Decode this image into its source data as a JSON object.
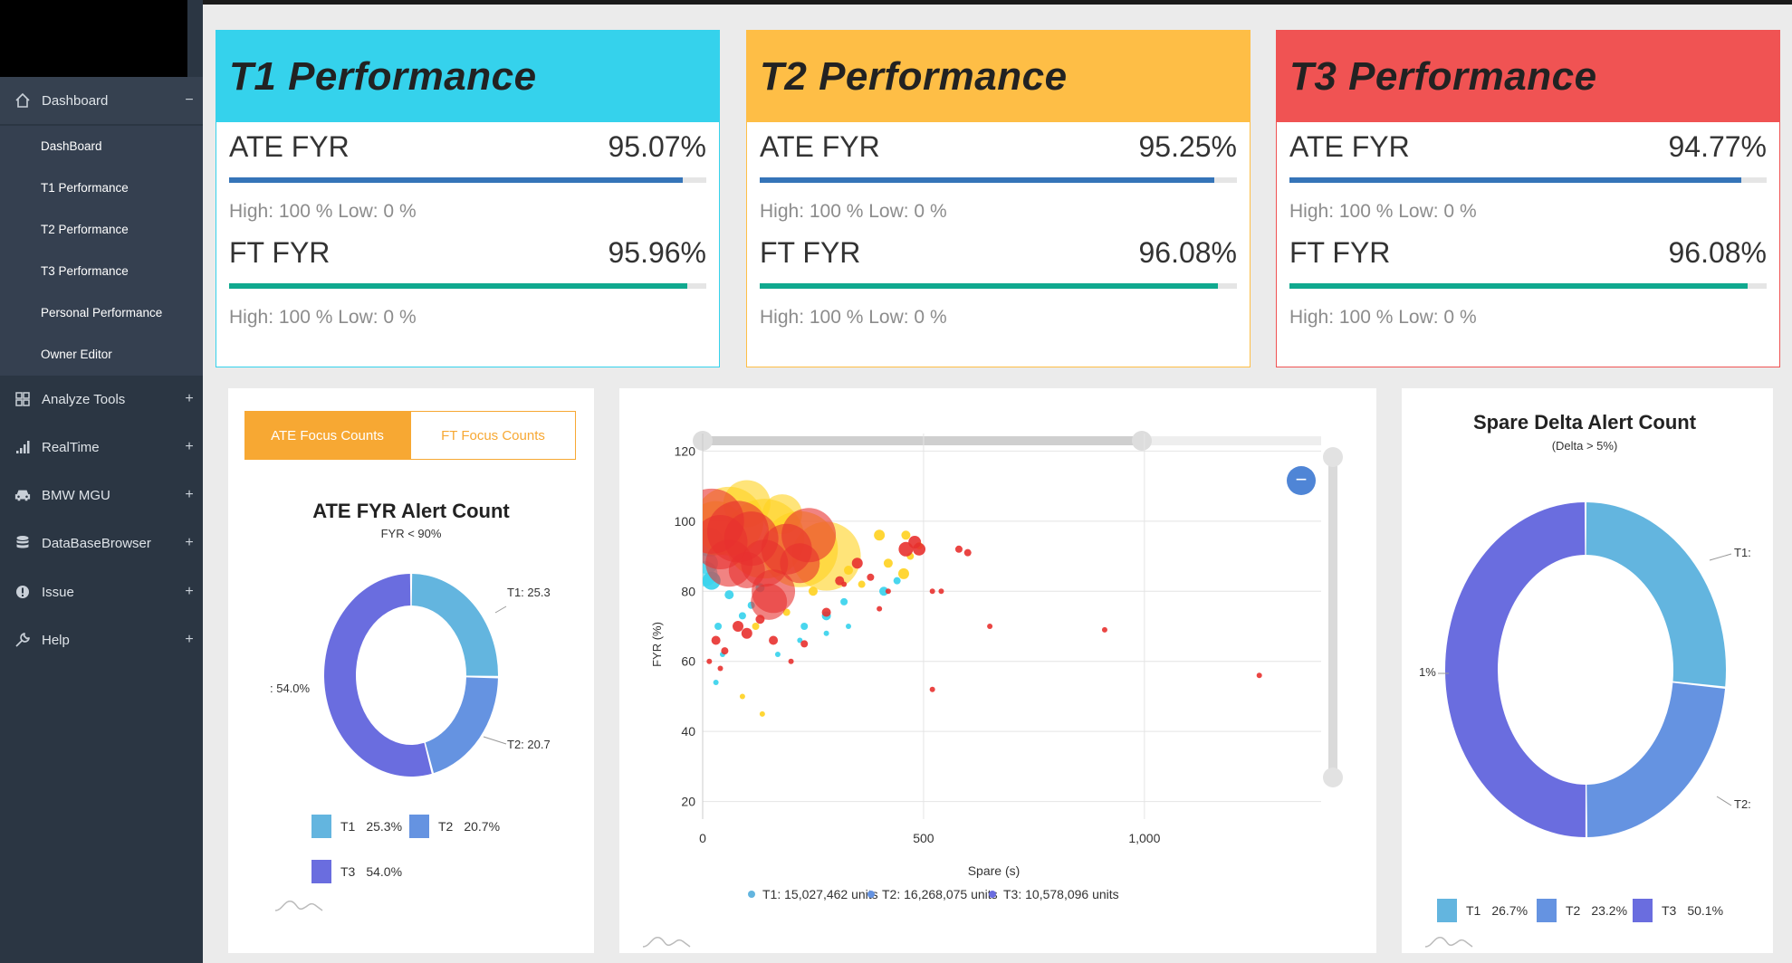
{
  "sidebar": {
    "items": [
      {
        "label": "Dashboard",
        "icon": "home-icon",
        "toggle": "−"
      },
      {
        "label": "Analyze Tools",
        "icon": "grid-icon",
        "toggle": "+"
      },
      {
        "label": "RealTime",
        "icon": "signal-icon",
        "toggle": "+"
      },
      {
        "label": "BMW MGU",
        "icon": "car-icon",
        "toggle": "+"
      },
      {
        "label": "DataBaseBrowser",
        "icon": "database-icon",
        "toggle": "+"
      },
      {
        "label": "Issue",
        "icon": "alert-icon",
        "toggle": "+"
      },
      {
        "label": "Help",
        "icon": "wrench-icon",
        "toggle": "+"
      }
    ],
    "subitems": [
      "DashBoard",
      "T1 Performance",
      "T2 Performance",
      "T3 Performance",
      "Personal Performance",
      "Owner Editor"
    ]
  },
  "cards": [
    {
      "title": "T1 Performance",
      "color": "#35d2ec",
      "ate_label": "ATE FYR",
      "ate_value": "95.07%",
      "ate_fill": 0.9507,
      "ate_range": "High: 100 % Low: 0 %",
      "ft_label": "FT FYR",
      "ft_value": "95.96%",
      "ft_fill": 0.9596,
      "ft_range": "High: 100 % Low: 0 %"
    },
    {
      "title": "T2 Performance",
      "color": "#febe46",
      "ate_label": "ATE FYR",
      "ate_value": "95.25%",
      "ate_fill": 0.9525,
      "ate_range": "High: 100 % Low: 0 %",
      "ft_label": "FT FYR",
      "ft_value": "96.08%",
      "ft_fill": 0.9608,
      "ft_range": "High: 100 % Low: 0 %"
    },
    {
      "title": "T3 Performance",
      "color": "#f05353",
      "ate_label": "ATE FYR",
      "ate_value": "94.77%",
      "ate_fill": 0.9477,
      "ate_range": "High: 100 % Low: 0 %",
      "ft_label": "FT FYR",
      "ft_value": "96.08%",
      "ft_fill": 0.9608,
      "ft_range": "High: 100 % Low: 0 %"
    }
  ],
  "colors": {
    "ate_bar": "#3574b8",
    "ft_bar": "#10a98f",
    "t1": "#63b5df",
    "t2": "#6593e1",
    "t3": "#6a6ddf",
    "accent_orange": "#f7a833"
  },
  "tabs": {
    "ate": "ATE Focus Counts",
    "ft": "FT Focus Counts"
  },
  "chart_data": [
    {
      "type": "donut",
      "title": "ATE FYR Alert Count",
      "subtitle": "FYR < 90%",
      "categories": [
        "T1",
        "T2",
        "T3"
      ],
      "values": [
        25.3,
        20.7,
        54.0
      ],
      "value_labels": [
        "25.3%",
        "20.7%",
        "54.0%"
      ],
      "annotations": [
        "T1: 25.3",
        "T2: 20.7",
        ": 54.0%"
      ],
      "legend": "bottom"
    },
    {
      "type": "scatter",
      "title": "",
      "xlabel": "Spare (s)",
      "ylabel": "FYR (%)",
      "xlim": [
        0,
        1400
      ],
      "ylim": [
        15,
        125
      ],
      "x_ticks": [
        "0",
        "500",
        "1,000"
      ],
      "y_ticks": [
        "120",
        "100",
        "80",
        "60",
        "40",
        "20"
      ],
      "grid": true,
      "legend": "bottom",
      "series": [
        {
          "name": "T1: 15,027,462 units",
          "color": "#35d2ec",
          "points": [
            [
              5,
              85,
              14
            ],
            [
              10,
              88,
              12
            ],
            [
              20,
              83,
              10
            ],
            [
              15,
              94,
              16
            ],
            [
              35,
              70,
              4
            ],
            [
              30,
              54,
              3
            ],
            [
              45,
              62,
              3
            ],
            [
              60,
              79,
              5
            ],
            [
              110,
              76,
              4
            ],
            [
              230,
              70,
              4
            ],
            [
              280,
              73,
              5
            ],
            [
              320,
              77,
              4
            ],
            [
              410,
              80,
              5
            ],
            [
              440,
              83,
              4
            ],
            [
              330,
              70,
              3
            ],
            [
              280,
              68,
              3
            ],
            [
              220,
              66,
              3
            ],
            [
              170,
              62,
              3
            ],
            [
              90,
              73,
              4
            ],
            [
              130,
              81,
              5
            ]
          ]
        },
        {
          "name": "T2: 16,268,075 units",
          "color": "#ffd21f",
          "points": [
            [
              60,
              100,
              38
            ],
            [
              140,
              95,
              44
            ],
            [
              220,
              92,
              42
            ],
            [
              280,
              90,
              38
            ],
            [
              30,
              98,
              30
            ],
            [
              100,
              105,
              26
            ],
            [
              180,
              102,
              22
            ],
            [
              90,
              50,
              3
            ],
            [
              135,
              45,
              3
            ],
            [
              400,
              96,
              6
            ],
            [
              420,
              88,
              5
            ],
            [
              455,
              85,
              6
            ],
            [
              470,
              90,
              4
            ],
            [
              490,
              93,
              4
            ],
            [
              460,
              96,
              5
            ],
            [
              360,
              82,
              4
            ],
            [
              330,
              86,
              5
            ],
            [
              250,
              80,
              5
            ],
            [
              190,
              74,
              4
            ],
            [
              120,
              70,
              4
            ]
          ]
        },
        {
          "name": "T3: 10,578,096 units",
          "color": "#e8312f",
          "points": [
            [
              20,
              100,
              36
            ],
            [
              40,
              94,
              30
            ],
            [
              80,
              97,
              34
            ],
            [
              60,
              88,
              26
            ],
            [
              110,
              95,
              30
            ],
            [
              140,
              88,
              26
            ],
            [
              160,
              80,
              24
            ],
            [
              190,
              92,
              28
            ],
            [
              240,
              96,
              30
            ],
            [
              220,
              88,
              22
            ],
            [
              150,
              77,
              20
            ],
            [
              100,
              86,
              20
            ],
            [
              80,
              70,
              6
            ],
            [
              100,
              68,
              6
            ],
            [
              130,
              72,
              5
            ],
            [
              160,
              66,
              5
            ],
            [
              30,
              66,
              5
            ],
            [
              50,
              63,
              4
            ],
            [
              230,
              65,
              4
            ],
            [
              280,
              74,
              5
            ],
            [
              310,
              83,
              5
            ],
            [
              350,
              88,
              6
            ],
            [
              460,
              92,
              8
            ],
            [
              480,
              94,
              7
            ],
            [
              490,
              92,
              7
            ],
            [
              580,
              92,
              4
            ],
            [
              600,
              91,
              4
            ],
            [
              650,
              70,
              3
            ],
            [
              520,
              80,
              3
            ],
            [
              910,
              69,
              3
            ],
            [
              520,
              52,
              3
            ],
            [
              1260,
              56,
              3
            ],
            [
              540,
              80,
              3
            ],
            [
              400,
              75,
              3
            ],
            [
              380,
              84,
              4
            ],
            [
              420,
              80,
              3
            ],
            [
              320,
              82,
              3
            ],
            [
              200,
              60,
              3
            ],
            [
              40,
              58,
              3
            ],
            [
              15,
              60,
              3
            ]
          ]
        }
      ]
    },
    {
      "type": "donut",
      "title": "Spare Delta Alert Count",
      "subtitle": "(Delta > 5%)",
      "categories": [
        "T1",
        "T2",
        "T3"
      ],
      "values": [
        26.7,
        23.2,
        50.1
      ],
      "value_labels": [
        "26.7%",
        "23.2%",
        "50.1%"
      ],
      "annotations": [
        "T1:",
        "T2:",
        "1%"
      ],
      "legend": "bottom"
    }
  ]
}
